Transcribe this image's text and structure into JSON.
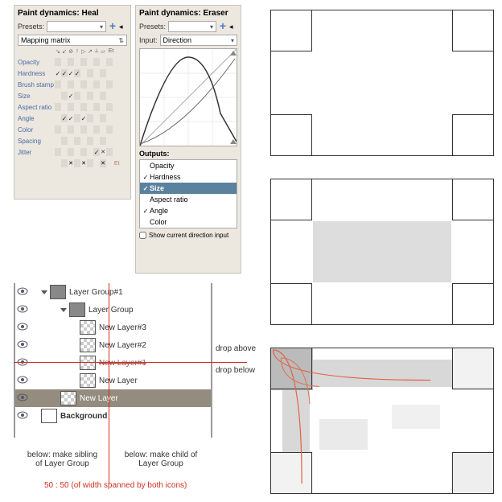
{
  "panel_heal": {
    "title": "Paint dynamics: Heal",
    "presets_label": "Presets:",
    "presets_value": "",
    "dropdown": "Mapping matrix",
    "icon_row": [
      "↘",
      "↙",
      "⊘",
      "↕",
      "▷",
      "↗",
      "⟂",
      "▱"
    ],
    "et": "Et",
    "rows": [
      "Opacity",
      "Hardness",
      "Brush stamp",
      "Size",
      "Aspect ratio",
      "Angle",
      "Color",
      "Spacing",
      "Jitter"
    ],
    "checks": {
      "Hardness": [
        0,
        1,
        2,
        3
      ],
      "Size": [
        2
      ],
      "Angle": [
        1,
        2,
        4
      ],
      "Jitter": [
        6
      ]
    },
    "x_marks": {
      "Jitter": [
        7
      ]
    }
  },
  "panel_eraser": {
    "title": "Paint dynamics: Eraser",
    "presets_label": "Presets:",
    "input_label": "Input:",
    "input_value": "Direction",
    "outputs_label": "Outputs:",
    "outputs": [
      {
        "label": "Opacity",
        "checked": false
      },
      {
        "label": "Hardness",
        "checked": true
      },
      {
        "label": "Size",
        "checked": true,
        "selected": true
      },
      {
        "label": "Aspect ratio",
        "checked": false
      },
      {
        "label": "Angle",
        "checked": true
      },
      {
        "label": "Color",
        "checked": false
      }
    ],
    "show_direction": "Show current direction input"
  },
  "layers": [
    {
      "name": "Layer Group#1",
      "indent": 0,
      "folder": true,
      "tri": true
    },
    {
      "name": "Layer Group",
      "indent": 1,
      "folder": true,
      "tri": true
    },
    {
      "name": "New Layer#3",
      "indent": 2
    },
    {
      "name": "New Layer#2",
      "indent": 2
    },
    {
      "name": "New Layer#1",
      "indent": 2,
      "struck": true
    },
    {
      "name": "New Layer",
      "indent": 2
    },
    {
      "name": "New Layer",
      "indent": 1,
      "sel": true
    },
    {
      "name": "Background",
      "indent": 0,
      "bold": true,
      "white": true
    }
  ],
  "annotations": {
    "drop_above": "drop above",
    "drop_below": "drop below",
    "sibling": "below: make sibling\nof Layer Group",
    "child": "below: make child of\nLayer Group",
    "ratio": "50 : 50 (of width spanned by both icons)"
  }
}
